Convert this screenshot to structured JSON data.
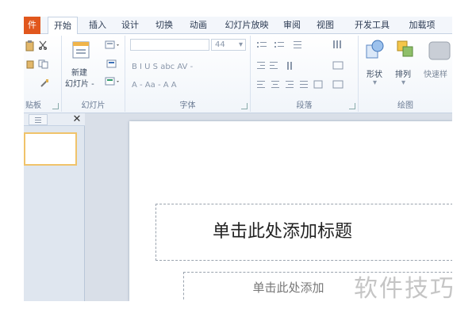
{
  "tabs": {
    "file": "件",
    "home": "开始",
    "insert": "插入",
    "design": "设计",
    "transition": "切换",
    "animation": "动画",
    "slideshow": "幻灯片放映",
    "review": "审阅",
    "view": "视图",
    "developer": "开发工具",
    "addins": "加载项"
  },
  "ribbon": {
    "clipboard": {
      "label": "贴板"
    },
    "slides": {
      "label": "幻灯片",
      "new_line1": "新建",
      "new_line2": "幻灯片 -"
    },
    "font": {
      "label": "字体",
      "size_value": "44",
      "styles": "B  I  U  S  abc  AV -",
      "size_buttons": "A -  Aa -  A  A  "
    },
    "paragraph": {
      "label": "段落"
    },
    "drawing": {
      "label": "绘图",
      "shapes": "形状",
      "arrange": "排列",
      "quick_styles": "快速样"
    }
  },
  "slide": {
    "title_placeholder": "单击此处添加标题",
    "subtitle_placeholder": "单击此处添加"
  },
  "watermark": "软件技巧",
  "colors": {
    "file_tab": "#e1571d",
    "ribbon_border": "#c5d2e3",
    "thumbnail_selected": "#f0c36a"
  }
}
